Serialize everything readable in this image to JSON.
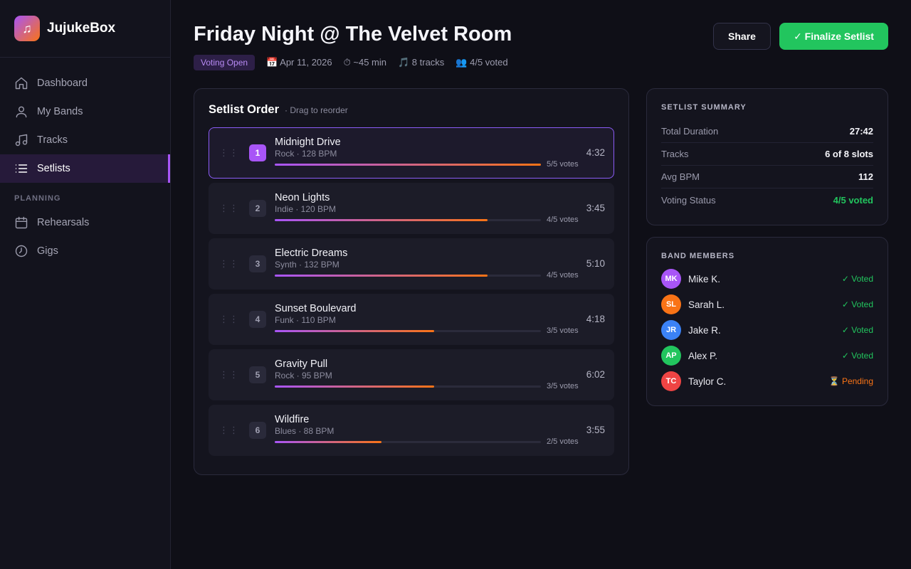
{
  "app": {
    "name": "JujukeBox",
    "logo_icon": "music-note-icon"
  },
  "sidebar": {
    "items": [
      {
        "label": "Dashboard",
        "icon": "home-icon"
      },
      {
        "label": "My Bands",
        "icon": "user-icon"
      },
      {
        "label": "Tracks",
        "icon": "music-icon"
      },
      {
        "label": "Setlists",
        "icon": "list-icon",
        "active": true
      }
    ],
    "section_label": "PLANNING",
    "planning_items": [
      {
        "label": "Rehearsals",
        "icon": "calendar-icon"
      },
      {
        "label": "Gigs",
        "icon": "clock-icon"
      }
    ]
  },
  "header": {
    "title": "Friday Night @ The Velvet Room",
    "status_badge": "Voting Open",
    "date": "📅 Apr 11, 2026",
    "duration": "⏱ ~45 min",
    "tracks": "🎵 8 tracks",
    "voted": "👥 4/5 voted",
    "share_label": "Share",
    "finalize_label": "✓ Finalize Setlist"
  },
  "setlist": {
    "title": "Setlist Order",
    "subtitle": "· Drag to reorder",
    "drag_glyph": "⋮⋮",
    "tracks": [
      {
        "num": "1",
        "name": "Midnight Drive",
        "meta": "Rock · 128 BPM",
        "votes": "5/5 votes",
        "vote_fraction": 1.0,
        "duration": "4:32"
      },
      {
        "num": "2",
        "name": "Neon Lights",
        "meta": "Indie · 120 BPM",
        "votes": "4/5 votes",
        "vote_fraction": 0.8,
        "duration": "3:45"
      },
      {
        "num": "3",
        "name": "Electric Dreams",
        "meta": "Synth · 132 BPM",
        "votes": "4/5 votes",
        "vote_fraction": 0.8,
        "duration": "5:10"
      },
      {
        "num": "4",
        "name": "Sunset Boulevard",
        "meta": "Funk · 110 BPM",
        "votes": "3/5 votes",
        "vote_fraction": 0.6,
        "duration": "4:18"
      },
      {
        "num": "5",
        "name": "Gravity Pull",
        "meta": "Rock · 95 BPM",
        "votes": "3/5 votes",
        "vote_fraction": 0.6,
        "duration": "6:02"
      },
      {
        "num": "6",
        "name": "Wildfire",
        "meta": "Blues · 88 BPM",
        "votes": "2/5 votes",
        "vote_fraction": 0.4,
        "duration": "3:55"
      }
    ]
  },
  "summary": {
    "title": "SETLIST SUMMARY",
    "rows": [
      {
        "label": "Total Duration",
        "value": "27:42"
      },
      {
        "label": "Tracks",
        "value": "6 of 8 slots"
      },
      {
        "label": "Avg BPM",
        "value": "112"
      },
      {
        "label": "Voting Status",
        "value": "4/5 voted"
      }
    ]
  },
  "members": {
    "title": "BAND MEMBERS",
    "list": [
      {
        "initials": "MK",
        "name": "Mike K.",
        "status": "✓ Voted",
        "color": "#a855f7"
      },
      {
        "initials": "SL",
        "name": "Sarah L.",
        "status": "✓ Voted",
        "color": "#f97316"
      },
      {
        "initials": "JR",
        "name": "Jake R.",
        "status": "✓ Voted",
        "color": "#3b82f6"
      },
      {
        "initials": "AP",
        "name": "Alex P.",
        "status": "✓ Voted",
        "color": "#22c55e"
      },
      {
        "initials": "TC",
        "name": "Taylor C.",
        "status": "⏳ Pending",
        "color": "#ef4444"
      }
    ]
  },
  "colors": {
    "accent": "#a855f7",
    "success": "#22c55e",
    "warning": "#f97316"
  }
}
